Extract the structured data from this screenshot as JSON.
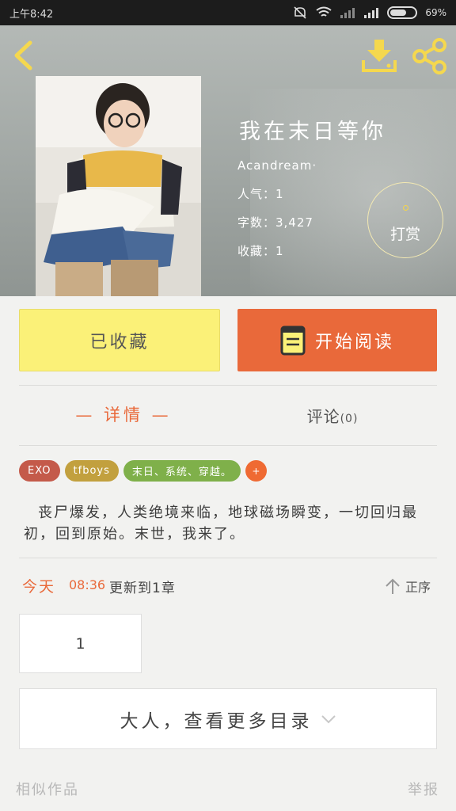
{
  "status_bar": {
    "time": "上午8:42",
    "battery": "69%",
    "battery_level": 0.69
  },
  "header": {
    "back_icon": "chevron-left-icon",
    "download_icon": "download-icon",
    "share_icon": "share-icon"
  },
  "book": {
    "title": "我在末日等你",
    "author": "Acandream·",
    "popularity": "人气：1",
    "word_count": "字数：3,427",
    "favorites": "收藏：1",
    "reward_label": "打赏"
  },
  "actions": {
    "collect_label": "已收藏",
    "read_label": "开始阅读",
    "read_icon": "book-icon"
  },
  "tabs": {
    "detail": "— 详情 —",
    "comments": "评论",
    "comments_count": "(0)"
  },
  "tags": [
    {
      "label": "EXO",
      "color": "#c45a4a"
    },
    {
      "label": "tfboys",
      "color": "#c2a03e"
    },
    {
      "label": "末日、系统、穿越。",
      "color": "#7fb04a"
    }
  ],
  "tag_add": "+",
  "synopsis": "丧尸爆发，人类绝境来临，地球磁场瞬变，一切回归最初，回到原始。末世，我来了。",
  "update": {
    "day": "今天",
    "time": "08:36",
    "text": "更新到1章",
    "sort_label": "正序"
  },
  "chapters": [
    "1"
  ],
  "more_catalog": "大人，查看更多目录",
  "footer": {
    "similar": "相似作品",
    "report": "举报"
  },
  "colors": {
    "accent": "#e9693a",
    "collect_bg": "#fbf178",
    "header_bg": "#a6aba8"
  }
}
